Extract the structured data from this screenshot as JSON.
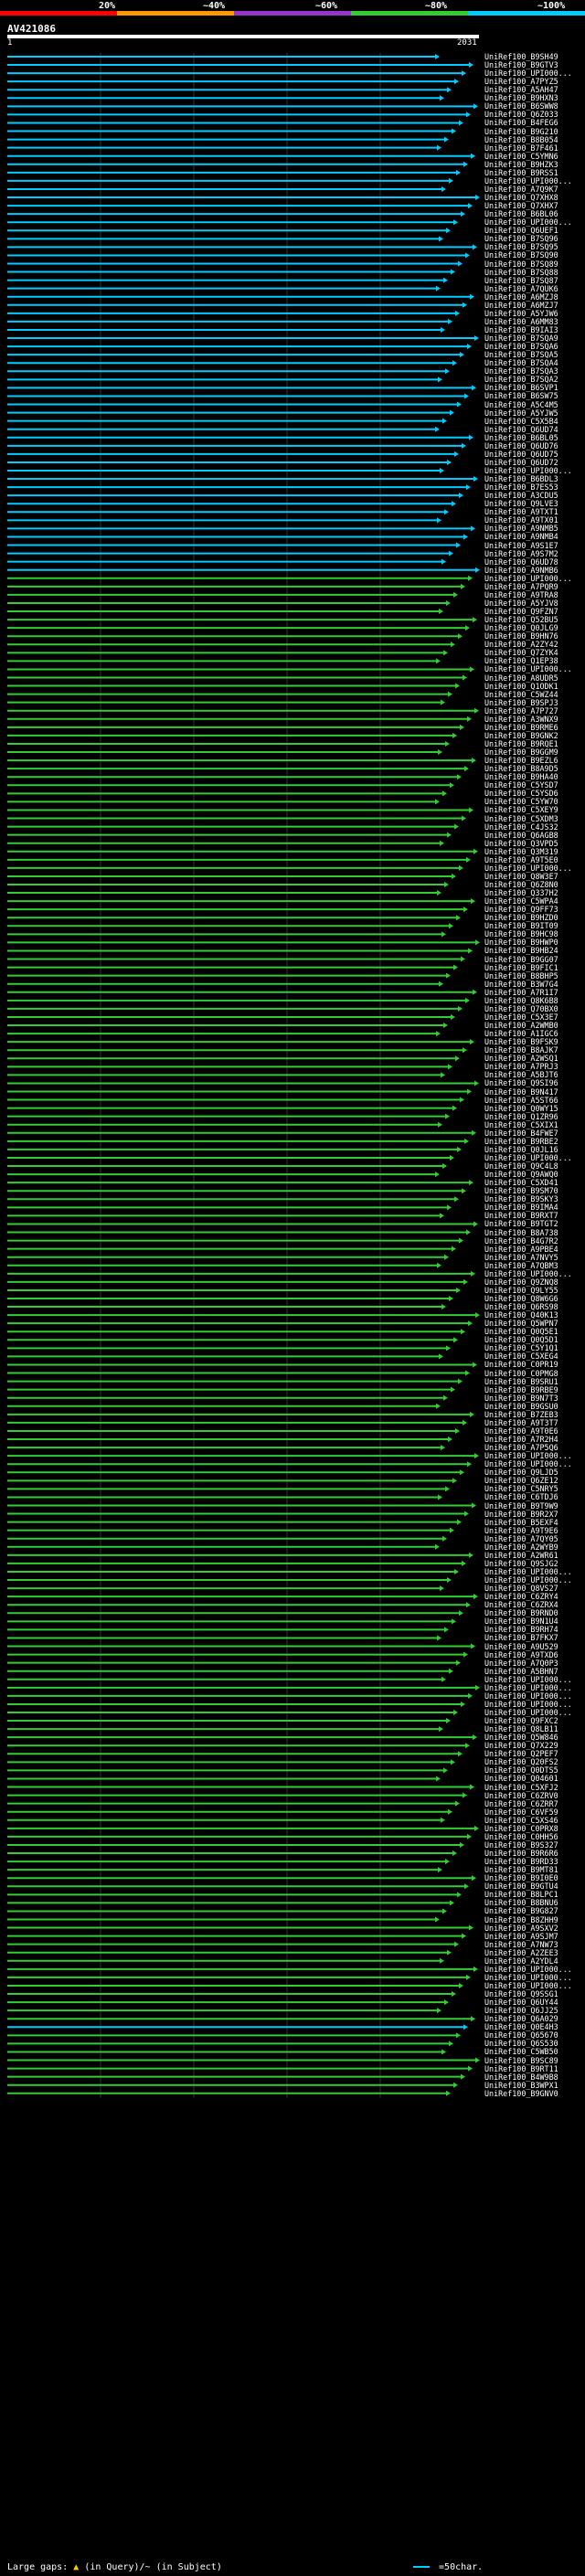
{
  "scale": {
    "labels": [
      "20%",
      "~40%",
      "~60%",
      "~80%",
      "~100%"
    ],
    "segments": [
      {
        "from": 0,
        "to": 0.2,
        "color": "#ff0000"
      },
      {
        "from": 0.2,
        "to": 0.4,
        "color": "#ff9900"
      },
      {
        "from": 0.4,
        "to": 0.6,
        "color": "#9933cc"
      },
      {
        "from": 0.6,
        "to": 0.8,
        "color": "#33cc33"
      },
      {
        "from": 0.8,
        "to": 1.0,
        "color": "#00ccff"
      }
    ]
  },
  "query": {
    "name": "AV421086",
    "start": "1",
    "end": "2031",
    "length": 2031
  },
  "colors": {
    "high": "#00ccff",
    "mid": "#33cc33",
    "gap": "#000000"
  },
  "hits": [
    {
      "label": "UniRef100_B9SH49",
      "color": "#00ccff"
    },
    {
      "label": "UniRef100_B9GTV3",
      "color": "#00ccff"
    },
    {
      "label": "UniRef100_UPI000...",
      "color": "#00ccff"
    },
    {
      "label": "UniRef100_A7PYZ5",
      "color": "#00ccff"
    },
    {
      "label": "UniRef100_A5AH47",
      "color": "#00ccff"
    },
    {
      "label": "UniRef100_B9HXN3",
      "color": "#00ccff"
    },
    {
      "label": "UniRef100_B6SWW8",
      "color": "#00ccff"
    },
    {
      "label": "UniRef100_Q6Z033",
      "color": "#00ccff"
    },
    {
      "label": "UniRef100_B4FEG6",
      "color": "#00ccff"
    },
    {
      "label": "UniRef100_B9G210",
      "color": "#00ccff"
    },
    {
      "label": "UniRef100_B8B054",
      "color": "#00ccff"
    },
    {
      "label": "UniRef100_B7F461",
      "color": "#00ccff"
    },
    {
      "label": "UniRef100_C5YMN6",
      "color": "#00ccff"
    },
    {
      "label": "UniRef100_B9HZK3",
      "color": "#00ccff"
    },
    {
      "label": "UniRef100_B9RSS1",
      "color": "#00ccff"
    },
    {
      "label": "UniRef100_UPI000...",
      "color": "#00ccff"
    },
    {
      "label": "UniRef100_A7Q9K7",
      "color": "#00ccff"
    },
    {
      "label": "UniRef100_Q7XHX8",
      "color": "#00ccff"
    },
    {
      "label": "UniRef100_Q7XHX7",
      "color": "#00ccff"
    },
    {
      "label": "UniRef100_B6BL06",
      "color": "#00ccff"
    },
    {
      "label": "UniRef100_UPI000...",
      "color": "#00ccff"
    },
    {
      "label": "UniRef100_Q6UEF1",
      "color": "#00ccff"
    },
    {
      "label": "UniRef100_B7SQ96",
      "color": "#00ccff"
    },
    {
      "label": "UniRef100_B7SQ95",
      "color": "#00ccff"
    },
    {
      "label": "UniRef100_B7SQ90",
      "color": "#00ccff"
    },
    {
      "label": "UniRef100_B7SQ89",
      "color": "#00ccff"
    },
    {
      "label": "UniRef100_B7SQ88",
      "color": "#00ccff"
    },
    {
      "label": "UniRef100_B7SQ87",
      "color": "#00ccff"
    },
    {
      "label": "UniRef100_A7QUK6",
      "color": "#00ccff"
    },
    {
      "label": "UniRef100_A6MZJ8",
      "color": "#00ccff"
    },
    {
      "label": "UniRef100_A6MZJ7",
      "color": "#00ccff"
    },
    {
      "label": "UniRef100_A5YJW6",
      "color": "#00ccff"
    },
    {
      "label": "UniRef100_A6MM83",
      "color": "#00ccff"
    },
    {
      "label": "UniRef100_B9IAI3",
      "color": "#00ccff"
    },
    {
      "label": "UniRef100_B7SQA9",
      "color": "#00ccff"
    },
    {
      "label": "UniRef100_B7SQA6",
      "color": "#00ccff"
    },
    {
      "label": "UniRef100_B7SQA5",
      "color": "#00ccff"
    },
    {
      "label": "UniRef100_B7SQA4",
      "color": "#00ccff"
    },
    {
      "label": "UniRef100_B7SQA3",
      "color": "#00ccff"
    },
    {
      "label": "UniRef100_B7SQA2",
      "color": "#00ccff"
    },
    {
      "label": "UniRef100_B6SVP1",
      "color": "#00ccff"
    },
    {
      "label": "UniRef100_B6SW75",
      "color": "#00ccff"
    },
    {
      "label": "UniRef100_A5C4M5",
      "color": "#00ccff"
    },
    {
      "label": "UniRef100_A5YJW5",
      "color": "#00ccff"
    },
    {
      "label": "UniRef100_C5X5B4",
      "color": "#00ccff"
    },
    {
      "label": "UniRef100_Q6UD74",
      "color": "#00ccff"
    },
    {
      "label": "UniRef100_B6BL05",
      "color": "#00ccff"
    },
    {
      "label": "UniRef100_Q6UD76",
      "color": "#00ccff"
    },
    {
      "label": "UniRef100_Q6UD75",
      "color": "#00ccff"
    },
    {
      "label": "UniRef100_Q6UD72",
      "color": "#00ccff"
    },
    {
      "label": "UniRef100_UPI000...",
      "color": "#00ccff"
    },
    {
      "label": "UniRef100_B6BDL3",
      "color": "#00ccff"
    },
    {
      "label": "UniRef100_B7ES53",
      "color": "#00ccff"
    },
    {
      "label": "UniRef100_A3CDU5",
      "color": "#00ccff"
    },
    {
      "label": "UniRef100_Q9LVE3",
      "color": "#00ccff"
    },
    {
      "label": "UniRef100_A9TXT1",
      "color": "#00ccff"
    },
    {
      "label": "UniRef100_A9TX01",
      "color": "#00ccff"
    },
    {
      "label": "UniRef100_A9NMB5",
      "color": "#00ccff"
    },
    {
      "label": "UniRef100_A9NMB4",
      "color": "#00ccff"
    },
    {
      "label": "UniRef100_A9S1E7",
      "color": "#00ccff"
    },
    {
      "label": "UniRef100_A9S7M2",
      "color": "#00ccff"
    },
    {
      "label": "UniRef100_Q6UD78",
      "color": "#00ccff"
    },
    {
      "label": "UniRef100_A9NMB6",
      "color": "#00ccff"
    },
    {
      "label": "UniRef100_UPI000...",
      "color": "#33cc33"
    },
    {
      "label": "UniRef100_A7PQR9",
      "color": "#33cc33"
    },
    {
      "label": "UniRef100_A9TRA8",
      "color": "#33cc33"
    },
    {
      "label": "UniRef100_A5YJV8",
      "color": "#33cc33"
    },
    {
      "label": "UniRef100_Q9FZN7",
      "color": "#33cc33"
    },
    {
      "label": "UniRef100_Q52BU5",
      "color": "#33cc33"
    },
    {
      "label": "UniRef100_Q0JLG9",
      "color": "#33cc33"
    },
    {
      "label": "UniRef100_B9HN76",
      "color": "#33cc33"
    },
    {
      "label": "UniRef100_A2ZY42",
      "color": "#33cc33"
    },
    {
      "label": "UniRef100_Q7ZYK4",
      "color": "#33cc33"
    },
    {
      "label": "UniRef100_Q1EP38",
      "color": "#33cc33"
    },
    {
      "label": "UniRef100_UPI000...",
      "color": "#33cc33"
    },
    {
      "label": "UniRef100_A8UDR5",
      "color": "#33cc33"
    },
    {
      "label": "UniRef100_Q1ODK1",
      "color": "#33cc33"
    },
    {
      "label": "UniRef100_C5WZ44",
      "color": "#33cc33"
    },
    {
      "label": "UniRef100_B9SPJ3",
      "color": "#33cc33"
    },
    {
      "label": "UniRef100_A7P727",
      "color": "#33cc33"
    },
    {
      "label": "UniRef100_A3WNX9",
      "color": "#33cc33"
    },
    {
      "label": "UniRef100_B9RME6",
      "color": "#33cc33"
    },
    {
      "label": "UniRef100_B9GNK2",
      "color": "#33cc33"
    },
    {
      "label": "UniRef100_B9RQE1",
      "color": "#33cc33"
    },
    {
      "label": "UniRef100_B9GGM9",
      "color": "#33cc33"
    },
    {
      "label": "UniRef100_B9EZL6",
      "color": "#33cc33"
    },
    {
      "label": "UniRef100_B8A9D5",
      "color": "#33cc33"
    },
    {
      "label": "UniRef100_B9HA40",
      "color": "#33cc33"
    },
    {
      "label": "UniRef100_C5YSD7",
      "color": "#33cc33"
    },
    {
      "label": "UniRef100_C5YSD6",
      "color": "#33cc33"
    },
    {
      "label": "UniRef100_C5YW70",
      "color": "#33cc33"
    },
    {
      "label": "UniRef100_C5XEY9",
      "color": "#33cc33"
    },
    {
      "label": "UniRef100_C5XDM3",
      "color": "#33cc33"
    },
    {
      "label": "UniRef100_C4JS32",
      "color": "#33cc33"
    },
    {
      "label": "UniRef100_Q6AGB8",
      "color": "#33cc33"
    },
    {
      "label": "UniRef100_Q3VPD5",
      "color": "#33cc33"
    },
    {
      "label": "UniRef100_Q3M319",
      "color": "#33cc33"
    },
    {
      "label": "UniRef100_A9T5E0",
      "color": "#33cc33"
    },
    {
      "label": "UniRef100_UPI000...",
      "color": "#33cc33"
    },
    {
      "label": "UniRef100_Q8W3E7",
      "color": "#33cc33"
    },
    {
      "label": "UniRef100_Q6Z8N0",
      "color": "#33cc33"
    },
    {
      "label": "UniRef100_Q337H2",
      "color": "#33cc33"
    },
    {
      "label": "UniRef100_C5WPA4",
      "color": "#33cc33"
    },
    {
      "label": "UniRef100_Q9FF73",
      "color": "#33cc33"
    },
    {
      "label": "UniRef100_B9HZD0",
      "color": "#33cc33"
    },
    {
      "label": "UniRef100_B9IT09",
      "color": "#33cc33"
    },
    {
      "label": "UniRef100_B9HC98",
      "color": "#33cc33"
    },
    {
      "label": "UniRef100_B9HWP0",
      "color": "#33cc33"
    },
    {
      "label": "UniRef100_B9HB24",
      "color": "#33cc33"
    },
    {
      "label": "UniRef100_B9GG07",
      "color": "#33cc33"
    },
    {
      "label": "UniRef100_B9FIC1",
      "color": "#33cc33"
    },
    {
      "label": "UniRef100_B8BHP5",
      "color": "#33cc33"
    },
    {
      "label": "UniRef100_B3W7G4",
      "color": "#33cc33"
    },
    {
      "label": "UniRef100_A7R1I7",
      "color": "#33cc33"
    },
    {
      "label": "UniRef100_Q8K6B8",
      "color": "#33cc33"
    },
    {
      "label": "UniRef100_Q70BX0",
      "color": "#33cc33"
    },
    {
      "label": "UniRef100_C5X3E7",
      "color": "#33cc33"
    },
    {
      "label": "UniRef100_A2WMB0",
      "color": "#33cc33"
    },
    {
      "label": "UniRef100_A1IGC6",
      "color": "#33cc33"
    },
    {
      "label": "UniRef100_B9FSK9",
      "color": "#33cc33"
    },
    {
      "label": "UniRef100_B8AJK7",
      "color": "#33cc33"
    },
    {
      "label": "UniRef100_A2WSQ1",
      "color": "#33cc33"
    },
    {
      "label": "UniRef100_A7PRJ3",
      "color": "#33cc33"
    },
    {
      "label": "UniRef100_A5BJT6",
      "color": "#33cc33"
    },
    {
      "label": "UniRef100_Q9SI96",
      "color": "#33cc33"
    },
    {
      "label": "UniRef100_B9N417",
      "color": "#33cc33"
    },
    {
      "label": "UniRef100_A5ST66",
      "color": "#33cc33"
    },
    {
      "label": "UniRef100_Q0WY15",
      "color": "#33cc33"
    },
    {
      "label": "UniRef100_Q1ZR96",
      "color": "#33cc33"
    },
    {
      "label": "UniRef100_C5XIX1",
      "color": "#33cc33"
    },
    {
      "label": "UniRef100_B4FWE7",
      "color": "#33cc33"
    },
    {
      "label": "UniRef100_B9RBE2",
      "color": "#33cc33"
    },
    {
      "label": "UniRef100_Q0JL16",
      "color": "#33cc33"
    },
    {
      "label": "UniRef100_UPI000...",
      "color": "#33cc33"
    },
    {
      "label": "UniRef100_Q9C4L8",
      "color": "#33cc33"
    },
    {
      "label": "UniRef100_Q9AWQ0",
      "color": "#33cc33"
    },
    {
      "label": "UniRef100_C5XD41",
      "color": "#33cc33"
    },
    {
      "label": "UniRef100_B9SM70",
      "color": "#33cc33"
    },
    {
      "label": "UniRef100_B9SKY3",
      "color": "#33cc33"
    },
    {
      "label": "UniRef100_B9IMA4",
      "color": "#33cc33"
    },
    {
      "label": "UniRef100_B9RXT7",
      "color": "#33cc33"
    },
    {
      "label": "UniRef100_B9TGT2",
      "color": "#33cc33"
    },
    {
      "label": "UniRef100_B8A738",
      "color": "#33cc33"
    },
    {
      "label": "UniRef100_B4G7R2",
      "color": "#33cc33"
    },
    {
      "label": "UniRef100_A9PBE4",
      "color": "#33cc33"
    },
    {
      "label": "UniRef100_A7NVY5",
      "color": "#33cc33"
    },
    {
      "label": "UniRef100_A7QBM3",
      "color": "#33cc33"
    },
    {
      "label": "UniRef100_UPI000...",
      "color": "#33cc33"
    },
    {
      "label": "UniRef100_Q9ZNQ8",
      "color": "#33cc33"
    },
    {
      "label": "UniRef100_Q9LY55",
      "color": "#33cc33"
    },
    {
      "label": "UniRef100_Q8W6G6",
      "color": "#33cc33"
    },
    {
      "label": "UniRef100_Q6RS98",
      "color": "#33cc33"
    },
    {
      "label": "UniRef100_Q40K13",
      "color": "#33cc33"
    },
    {
      "label": "UniRef100_Q5WPN7",
      "color": "#33cc33"
    },
    {
      "label": "UniRef100_Q0Q5E1",
      "color": "#33cc33"
    },
    {
      "label": "UniRef100_Q0Q5D1",
      "color": "#33cc33"
    },
    {
      "label": "UniRef100_C5Y1Q1",
      "color": "#33cc33"
    },
    {
      "label": "UniRef100_C5XEG4",
      "color": "#33cc33"
    },
    {
      "label": "UniRef100_C0PR19",
      "color": "#33cc33"
    },
    {
      "label": "UniRef100_C0PMG8",
      "color": "#33cc33"
    },
    {
      "label": "UniRef100_B9SRU1",
      "color": "#33cc33"
    },
    {
      "label": "UniRef100_B9RBE9",
      "color": "#33cc33"
    },
    {
      "label": "UniRef100_B9N7T3",
      "color": "#33cc33"
    },
    {
      "label": "UniRef100_B9GSU0",
      "color": "#33cc33"
    },
    {
      "label": "UniRef100_B7ZEB3",
      "color": "#33cc33"
    },
    {
      "label": "UniRef100_A9T3T7",
      "color": "#33cc33"
    },
    {
      "label": "UniRef100_A9T0E6",
      "color": "#33cc33"
    },
    {
      "label": "UniRef100_A7R2H4",
      "color": "#33cc33"
    },
    {
      "label": "UniRef100_A7P5Q6",
      "color": "#33cc33"
    },
    {
      "label": "UniRef100_UPI000...",
      "color": "#33cc33"
    },
    {
      "label": "UniRef100_UPI000...",
      "color": "#33cc33"
    },
    {
      "label": "UniRef100_Q9LJD5",
      "color": "#33cc33"
    },
    {
      "label": "UniRef100_Q6ZE12",
      "color": "#33cc33"
    },
    {
      "label": "UniRef100_C5NRY5",
      "color": "#33cc33"
    },
    {
      "label": "UniRef100_C6TDJ6",
      "color": "#33cc33"
    },
    {
      "label": "UniRef100_B9T9W9",
      "color": "#33cc33"
    },
    {
      "label": "UniRef100_B9R2X7",
      "color": "#33cc33"
    },
    {
      "label": "UniRef100_B5EXF4",
      "color": "#33cc33"
    },
    {
      "label": "UniRef100_A9T9E6",
      "color": "#33cc33"
    },
    {
      "label": "UniRef100_A7QY05",
      "color": "#33cc33"
    },
    {
      "label": "UniRef100_A2WYB9",
      "color": "#33cc33"
    },
    {
      "label": "UniRef100_A2WR61",
      "color": "#33cc33"
    },
    {
      "label": "UniRef100_Q9SJG2",
      "color": "#33cc33"
    },
    {
      "label": "UniRef100_UPI000...",
      "color": "#33cc33"
    },
    {
      "label": "UniRef100_UPI000...",
      "color": "#33cc33"
    },
    {
      "label": "UniRef100_Q8VS27",
      "color": "#33cc33"
    },
    {
      "label": "UniRef100_C6ZRY4",
      "color": "#33cc33"
    },
    {
      "label": "UniRef100_C6ZRX4",
      "color": "#33cc33"
    },
    {
      "label": "UniRef100_B9RND0",
      "color": "#33cc33"
    },
    {
      "label": "UniRef100_B9N1U4",
      "color": "#33cc33"
    },
    {
      "label": "UniRef100_B9RH74",
      "color": "#33cc33"
    },
    {
      "label": "UniRef100_B7FKX7",
      "color": "#33cc33"
    },
    {
      "label": "UniRef100_A9U529",
      "color": "#33cc33"
    },
    {
      "label": "UniRef100_A9TXD6",
      "color": "#33cc33"
    },
    {
      "label": "UniRef100_A7Q0P3",
      "color": "#33cc33"
    },
    {
      "label": "UniRef100_A5BHN7",
      "color": "#33cc33"
    },
    {
      "label": "UniRef100_UPI000...",
      "color": "#33cc33"
    },
    {
      "label": "UniRef100_UPI000...",
      "color": "#33cc33"
    },
    {
      "label": "UniRef100_UPI000...",
      "color": "#33cc33"
    },
    {
      "label": "UniRef100_UPI000...",
      "color": "#33cc33"
    },
    {
      "label": "UniRef100_UPI000...",
      "color": "#33cc33"
    },
    {
      "label": "UniRef100_Q9FXC2",
      "color": "#33cc33"
    },
    {
      "label": "UniRef100_Q8LB11",
      "color": "#33cc33"
    },
    {
      "label": "UniRef100_Q5W846",
      "color": "#33cc33"
    },
    {
      "label": "UniRef100_Q7X229",
      "color": "#33cc33"
    },
    {
      "label": "UniRef100_Q2PEF7",
      "color": "#33cc33"
    },
    {
      "label": "UniRef100_Q20FS2",
      "color": "#33cc33"
    },
    {
      "label": "UniRef100_Q0DTS5",
      "color": "#33cc33"
    },
    {
      "label": "UniRef100_Q04601",
      "color": "#33cc33"
    },
    {
      "label": "UniRef100_C5XFJ2",
      "color": "#33cc33"
    },
    {
      "label": "UniRef100_C6ZRV0",
      "color": "#33cc33"
    },
    {
      "label": "UniRef100_C6ZRR7",
      "color": "#33cc33"
    },
    {
      "label": "UniRef100_C6VF59",
      "color": "#33cc33"
    },
    {
      "label": "UniRef100_C5XS46",
      "color": "#33cc33"
    },
    {
      "label": "UniRef100_C0PRX8",
      "color": "#33cc33"
    },
    {
      "label": "UniRef100_C0HH56",
      "color": "#33cc33"
    },
    {
      "label": "UniRef100_B9S327",
      "color": "#33cc33"
    },
    {
      "label": "UniRef100_B9R6R6",
      "color": "#33cc33"
    },
    {
      "label": "UniRef100_B9RD33",
      "color": "#33cc33"
    },
    {
      "label": "UniRef100_B9MT81",
      "color": "#33cc33"
    },
    {
      "label": "UniRef100_B9I0E0",
      "color": "#33cc33"
    },
    {
      "label": "UniRef100_B9GTU4",
      "color": "#33cc33"
    },
    {
      "label": "UniRef100_B8LPC1",
      "color": "#33cc33"
    },
    {
      "label": "UniRef100_B8BNU6",
      "color": "#33cc33"
    },
    {
      "label": "UniRef100_B9G827",
      "color": "#33cc33"
    },
    {
      "label": "UniRef100_B8ZHH9",
      "color": "#33cc33"
    },
    {
      "label": "UniRef100_A9SXV2",
      "color": "#33cc33"
    },
    {
      "label": "UniRef100_A9SJM7",
      "color": "#33cc33"
    },
    {
      "label": "UniRef100_A7NW73",
      "color": "#33cc33"
    },
    {
      "label": "UniRef100_A2ZEE3",
      "color": "#33cc33"
    },
    {
      "label": "UniRef100_A2YDL4",
      "color": "#33cc33"
    },
    {
      "label": "UniRef100_UPI000...",
      "color": "#33cc33"
    },
    {
      "label": "UniRef100_UPI000...",
      "color": "#33cc33"
    },
    {
      "label": "UniRef100_UPI000...",
      "color": "#33cc33"
    },
    {
      "label": "UniRef100_Q9SSG1",
      "color": "#33cc33"
    },
    {
      "label": "UniRef100_Q6UY44",
      "color": "#33cc33"
    },
    {
      "label": "UniRef100_Q6JJ25",
      "color": "#33cc33"
    },
    {
      "label": "UniRef100_Q6A029",
      "color": "#33cc33"
    },
    {
      "label": "UniRef100_Q0E4H3",
      "color": "#00ccff"
    },
    {
      "label": "UniRef100_Q65670",
      "color": "#33cc33"
    },
    {
      "label": "UniRef100_Q6S530",
      "color": "#33cc33"
    },
    {
      "label": "UniRef100_C5WB50",
      "color": "#33cc33"
    },
    {
      "label": "UniRef100_B9SC89",
      "color": "#33cc33"
    },
    {
      "label": "UniRef100_B9RT11",
      "color": "#33cc33"
    },
    {
      "label": "UniRef100_B4W9B8",
      "color": "#33cc33"
    },
    {
      "label": "UniRef100_B3WPX1",
      "color": "#33cc33"
    },
    {
      "label": "UniRef100_B9GNV0",
      "color": "#33cc33"
    }
  ],
  "footer": {
    "left_label": "Large gaps:",
    "left_text": "(in Query)/~ (in Subject)",
    "right_text": "=50char."
  }
}
